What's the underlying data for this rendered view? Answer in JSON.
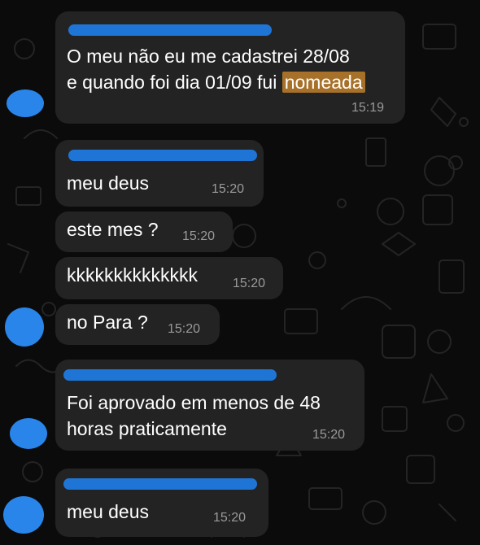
{
  "colors": {
    "background": "#0b0b0b",
    "bubble": "#232323",
    "text": "#ffffff",
    "timestamp": "#9a9a9a",
    "highlight": "#a8712a",
    "redaction": "#1f7ae0"
  },
  "messages": [
    {
      "line1": "O meu não eu me cadastrei  28/08",
      "line2_before": "e quando foi dia 01/09 fui ",
      "line2_highlight": "nomeada",
      "time": "15:19"
    },
    {
      "text": "meu deus",
      "time": "15:20"
    },
    {
      "text": "este mes ?",
      "time": "15:20"
    },
    {
      "text": "kkkkkkkkkkkkkk",
      "time": "15:20"
    },
    {
      "text": "no Para ?",
      "time": "15:20"
    },
    {
      "line1": "Foi aprovado em menos de 48",
      "line2": "horas praticamente",
      "time": "15:20"
    },
    {
      "text": "meu deus",
      "time": "15:20"
    }
  ]
}
